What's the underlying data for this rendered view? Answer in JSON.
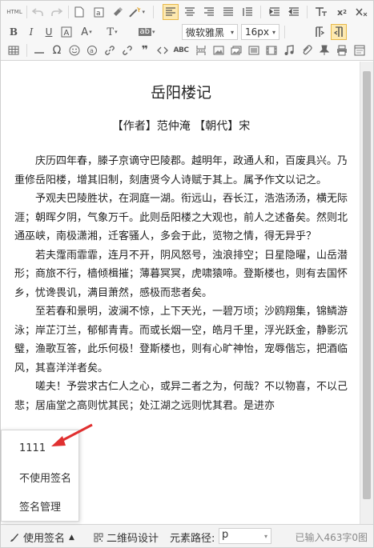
{
  "toolbar": {
    "html_label": "HTML",
    "font_family": "微软雅黑",
    "font_size": "16px",
    "row1_icons": [
      "html-icon",
      "undo-icon",
      "redo-icon",
      "new-document-icon",
      "paste-text-icon",
      "format-brush-icon",
      "magic-wand-icon",
      "align-left-icon",
      "align-center-icon",
      "align-right-icon",
      "justify-icon",
      "line-spacing-icon",
      "superscript-icon",
      "subscript-icon",
      "eraser-icon"
    ],
    "row2_icons": [
      "bold-icon",
      "italic-icon",
      "underline-icon",
      "font-border-icon",
      "font-color-icon",
      "text-format-icon",
      "background-color-icon",
      "font-family-select",
      "font-size-select",
      "paragraph-left-icon",
      "paragraph-right-icon"
    ],
    "row3_icons": [
      "table-icon",
      "horizontal-line-icon",
      "special-char-icon",
      "emoji-icon",
      "anchor-icon",
      "link-icon",
      "unlink-icon",
      "quote-icon",
      "spellcheck-icon",
      "code-icon",
      "image-icon",
      "multi-image-icon",
      "video-icon",
      "music-icon",
      "attachment-icon",
      "print-icon",
      "preview-icon"
    ]
  },
  "document": {
    "title": "岳阳楼记",
    "meta": "【作者】范仲淹 【朝代】宋",
    "paragraphs": [
      "庆历四年春，滕子京谪守巴陵郡。越明年，政通人和，百废具兴。乃重修岳阳楼，增其旧制，刻唐贤今人诗赋于其上。属予作文以记之。",
      "予观夫巴陵胜状，在洞庭一湖。衔远山，吞长江，浩浩汤汤，横无际涯；朝晖夕阴，气象万千。此则岳阳楼之大观也，前人之述备矣。然则北通巫峡，南极潇湘，迁客骚人，多会于此，览物之情，得无异乎？",
      "若夫霪雨霏霏，连月不开，阴风怒号，浊浪排空；日星隐曜，山岳潜形；商旅不行，樯倾楫摧；薄暮冥冥，虎啸猿啼。登斯楼也，则有去国怀乡，忧谗畏讥，满目萧然，感极而悲者矣。",
      "至若春和景明，波澜不惊，上下天光，一碧万顷；沙鸥翔集，锦鳞游泳；岸芷汀兰，郁郁青青。而或长烟一空，皓月千里，浮光跃金，静影沉璧，渔歌互答，此乐何极！登斯楼也，则有心旷神怡，宠辱偕忘，把酒临风，其喜洋洋者矣。",
      "嗟夫！予尝求古仁人之心，或异二者之为，何哉？不以物喜，不以己悲；居庙堂之高则忧其民；处江湖之远则忧其君。是进亦"
    ]
  },
  "popup": {
    "items": [
      "1111",
      "不使用签名",
      "签名管理"
    ]
  },
  "statusbar": {
    "signature_label": "使用签名",
    "qrcode_label": "二维码设计",
    "path_label": "元素路径:",
    "path_value": "p",
    "counter": "已输入463字0图"
  },
  "colors": {
    "toolbar_bg": "#f7f7f7",
    "active_bg": "#fde9b0",
    "annotation_arrow": "#e03030"
  }
}
